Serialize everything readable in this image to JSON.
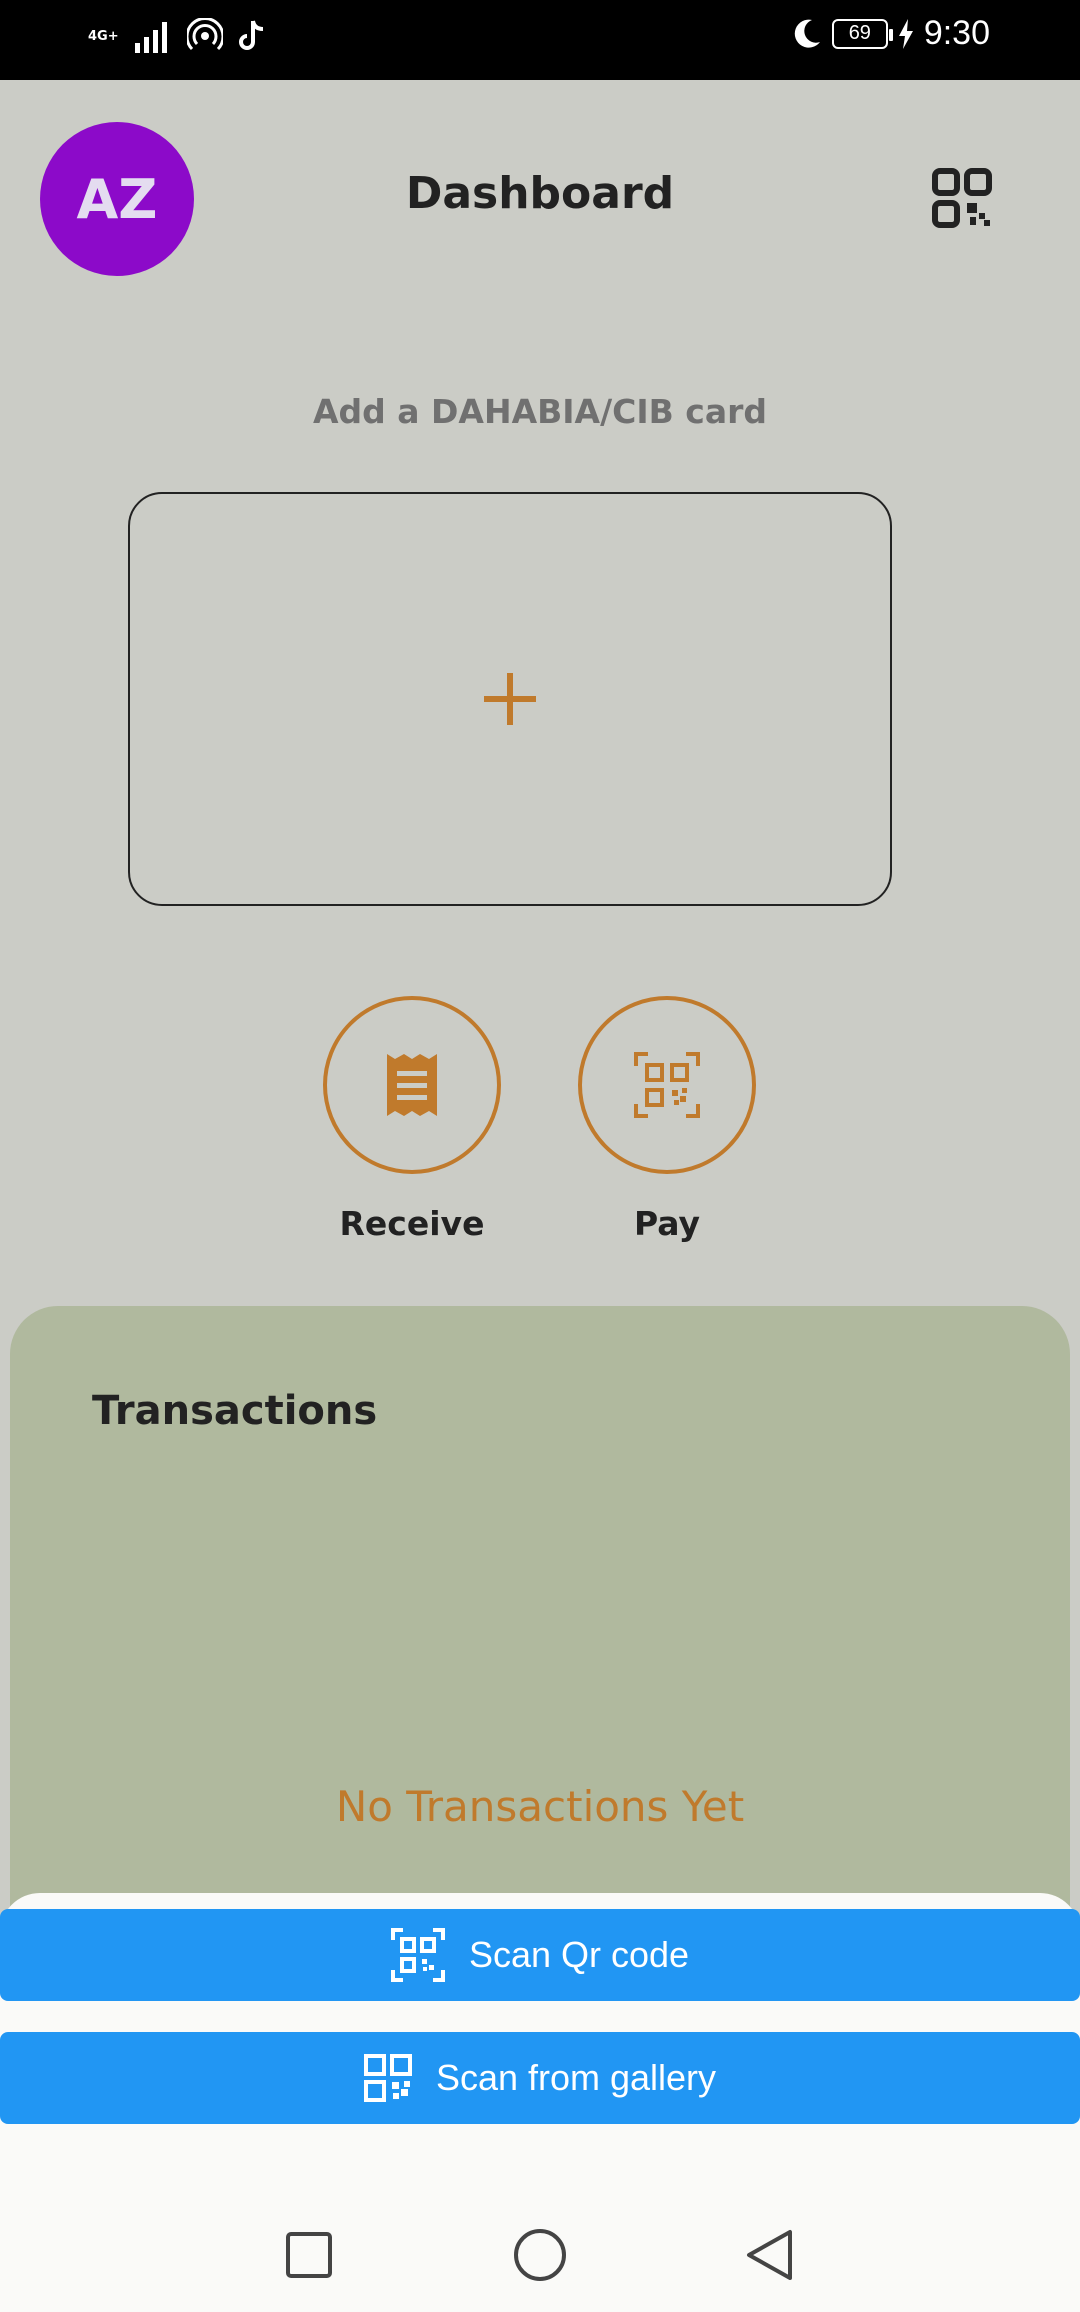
{
  "status_bar": {
    "network": "4G+",
    "battery": "69",
    "time": "9:30"
  },
  "header": {
    "avatar_initials": "AZ",
    "title": "Dashboard"
  },
  "card_section": {
    "label": "Add a DAHABIA/CIB card"
  },
  "actions": [
    {
      "label": "Receive",
      "icon": "receipt-icon"
    },
    {
      "label": "Pay",
      "icon": "qr-scan-icon"
    }
  ],
  "transactions": {
    "title": "Transactions",
    "empty_text": "No Transactions Yet"
  },
  "bottom_sheet": {
    "scan_qr_label": "Scan Qr code",
    "scan_gallery_label": "Scan from gallery"
  },
  "colors": {
    "avatar": "#8c0ac9",
    "accent": "#c07a2c",
    "primary_button": "#2196f3",
    "panel": "#b0b99e",
    "background": "#cbccc6"
  }
}
